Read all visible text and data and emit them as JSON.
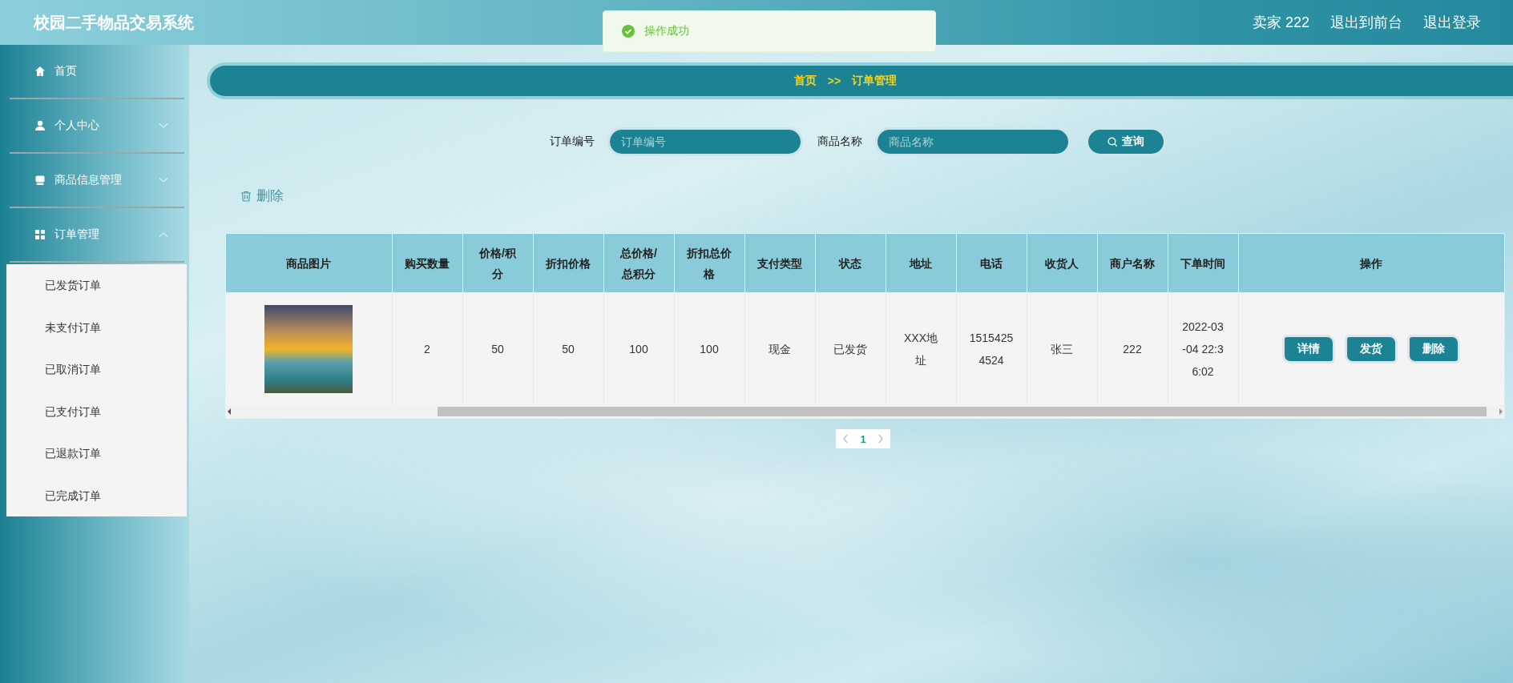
{
  "header": {
    "title": "校园二手物品交易系统",
    "user": "卖家 222",
    "links": [
      {
        "label": "退出到前台"
      },
      {
        "label": "退出登录"
      }
    ]
  },
  "toast": {
    "message": "操作成功"
  },
  "sidebar": {
    "items": [
      {
        "label": "首页",
        "kind": "link"
      },
      {
        "label": "个人中心",
        "kind": "submenu",
        "expanded": false
      },
      {
        "label": "商品信息管理",
        "kind": "submenu",
        "expanded": false
      },
      {
        "label": "订单管理",
        "kind": "submenu",
        "expanded": true,
        "children": [
          {
            "label": "已发货订单"
          },
          {
            "label": "未支付订单"
          },
          {
            "label": "已取消订单"
          },
          {
            "label": "已支付订单"
          },
          {
            "label": "已退款订单"
          },
          {
            "label": "已完成订单"
          }
        ]
      }
    ]
  },
  "breadcrumb": {
    "items": [
      "首页",
      "订单管理"
    ],
    "separator": ">>"
  },
  "search": {
    "fields": [
      {
        "label": "订单编号",
        "placeholder": "订单编号"
      },
      {
        "label": "商品名称",
        "placeholder": "商品名称"
      }
    ],
    "button": "查询"
  },
  "toolbar": {
    "delete": "删除"
  },
  "table": {
    "columns": [
      "商品图片",
      "购买数量",
      "价格/积分",
      "折扣价格",
      "总价格/总积分",
      "折扣总价格",
      "支付类型",
      "状态",
      "地址",
      "电话",
      "收货人",
      "商户名称",
      "下单时间",
      "操作"
    ],
    "rows": [
      {
        "cells": [
          "",
          "2",
          "50",
          "50",
          "100",
          "100",
          "现金",
          "已发货",
          "XXX地址",
          "15154254524",
          "张三",
          "222",
          "2022-03-04 22:36:02"
        ],
        "actions": [
          "详情",
          "发货",
          "删除"
        ]
      }
    ]
  },
  "pagination": {
    "pages": [
      {
        "label": "1",
        "selected": true
      }
    ]
  }
}
